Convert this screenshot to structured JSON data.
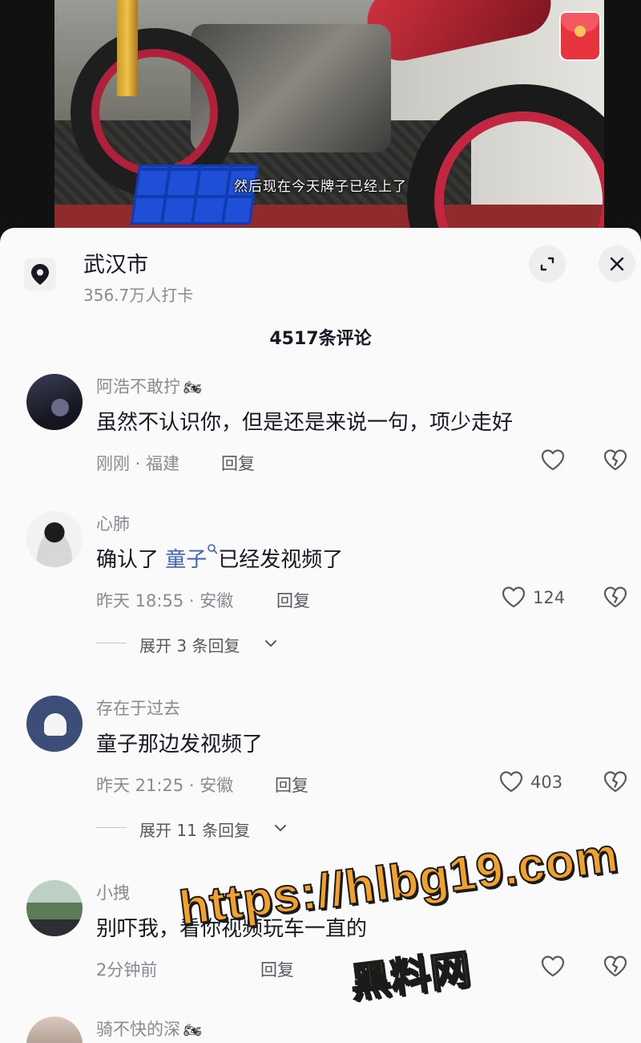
{
  "video": {
    "subtitle": "然后现在今天牌子已经上了"
  },
  "location": {
    "city": "武汉市",
    "checkins": "356.7万人打卡"
  },
  "comments_title": "4517条评论",
  "comments": [
    {
      "username": "阿浩不敢拧",
      "username_badge": "🏍",
      "text": "虽然不认识你，但是还是来说一句，项少走好",
      "meta": "刚刚 · 福建",
      "reply_label": "回复",
      "likes": ""
    },
    {
      "username": "心肺",
      "text_before": "确认了 ",
      "mention": "童子",
      "text_after": "已经发视频了",
      "meta": "昨天 18:55 · 安徽",
      "reply_label": "回复",
      "likes": "124",
      "expand_label": "展开 3 条回复"
    },
    {
      "username": "存在于过去",
      "text": "童子那边发视频了",
      "meta": "昨天 21:25 · 安徽",
      "reply_label": "回复",
      "likes": "403",
      "expand_label": "展开 11 条回复"
    },
    {
      "username": "小拽",
      "text": "别吓我，看你视频玩车一直的",
      "meta": "2分钟前",
      "reply_label": "回复",
      "likes": ""
    },
    {
      "username": "骑不快的深",
      "username_badge": "🏍"
    }
  ],
  "watermark": {
    "url": "https://hlbg19.com",
    "name": "黑料网"
  },
  "icons": {
    "location": "location-pin-icon",
    "expand": "expand-icon",
    "close": "close-icon",
    "like": "heart-icon",
    "dislike": "broken-heart-icon",
    "chevron": "chevron-down-icon",
    "red_packet": "red-packet-icon"
  }
}
